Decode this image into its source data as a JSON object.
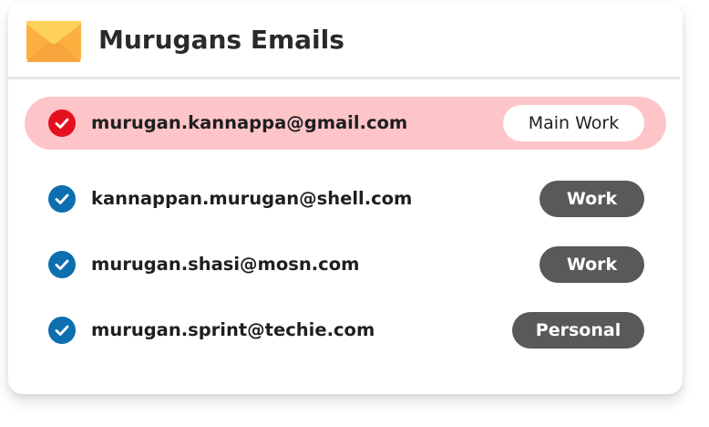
{
  "header": {
    "title": "Murugans Emails",
    "icon": "envelope-icon"
  },
  "colors": {
    "selected_row_bg": "#fec5c8",
    "selected_check": "#e5101f",
    "check": "#0d6fb0",
    "tag_dark": "#595959",
    "tag_light": "#ffffff"
  },
  "emails": [
    {
      "address": "murugan.kannappa@gmail.com",
      "tag": "Main Work",
      "selected": true
    },
    {
      "address": "kannappan.murugan@shell.com",
      "tag": "Work",
      "selected": false
    },
    {
      "address": "murugan.shasi@mosn.com",
      "tag": "Work",
      "selected": false
    },
    {
      "address": "murugan.sprint@techie.com",
      "tag": "Personal",
      "selected": false
    }
  ]
}
